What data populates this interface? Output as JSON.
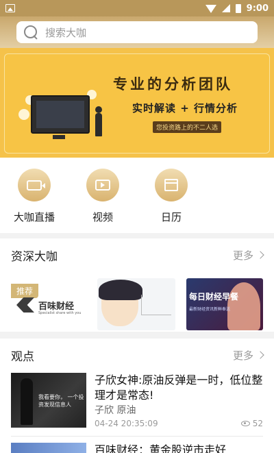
{
  "status_bar": {
    "time": "9:00"
  },
  "search": {
    "placeholder": "搜索大咖"
  },
  "banner": {
    "title": "专业的分析团队",
    "subtitle": "实时解读 + 行情分析",
    "tag": "您投资路上的不二人选"
  },
  "quick_menu": [
    {
      "label": "大咖直播",
      "icon": "live-camera-icon"
    },
    {
      "label": "视频",
      "icon": "video-play-icon"
    },
    {
      "label": "日历",
      "icon": "calendar-icon"
    }
  ],
  "experts": {
    "title": "资深大咖",
    "more": "更多",
    "cards": [
      {
        "tag": "推荐",
        "name": "百味财经",
        "slogan": "Specialist share with you"
      },
      {
        "name": "anime-analyst"
      },
      {
        "title": "每日财经早餐",
        "subtitle": "最新财经资讯新鲜奉送"
      }
    ]
  },
  "views": {
    "title": "观点",
    "more": "更多",
    "articles": [
      {
        "title": "子欣女神:原油反弹是一时，低位整理才是常态!",
        "author": "子欣 原油",
        "time": "04-24 20:35:09",
        "views": "52",
        "thumb_text": "我看要你，\n一个投资发现信息人"
      },
      {
        "title": "百味财经：黄金股逆市走好"
      }
    ]
  },
  "colors": {
    "header_gold": "#c9a86d",
    "banner_yellow": "#f5c24a",
    "accent_gold": "#d3b676"
  }
}
